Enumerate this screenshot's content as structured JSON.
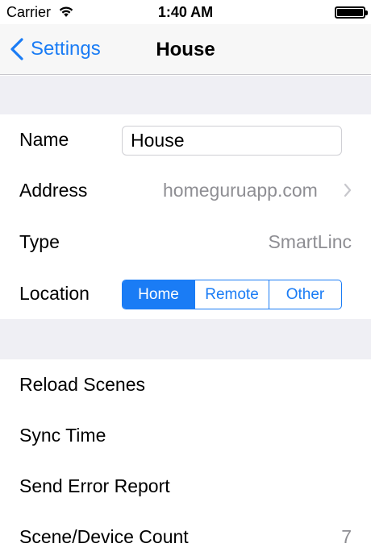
{
  "status_bar": {
    "carrier": "Carrier",
    "time": "1:40 AM",
    "wifi_icon": "wifi-icon",
    "battery_icon": "battery-icon"
  },
  "nav": {
    "back_label": "Settings",
    "title": "House",
    "back_icon": "chevron-left-icon"
  },
  "house_settings": {
    "name": {
      "label": "Name",
      "value": "House"
    },
    "address": {
      "label": "Address",
      "value": "homeguruapp.com",
      "icon": "chevron-right-icon"
    },
    "type": {
      "label": "Type",
      "value": "SmartLinc"
    },
    "location": {
      "label": "Location",
      "options": [
        "Home",
        "Remote",
        "Other"
      ],
      "selected": "Home"
    }
  },
  "actions": {
    "reload_scenes": "Reload Scenes",
    "sync_time": "Sync Time",
    "send_error_report": "Send Error Report",
    "scene_device_count": {
      "label": "Scene/Device Count",
      "value": "7"
    }
  },
  "colors": {
    "accent": "#1a7cf5",
    "section_background": "#efeff4",
    "secondary_text": "#8e8e93"
  }
}
